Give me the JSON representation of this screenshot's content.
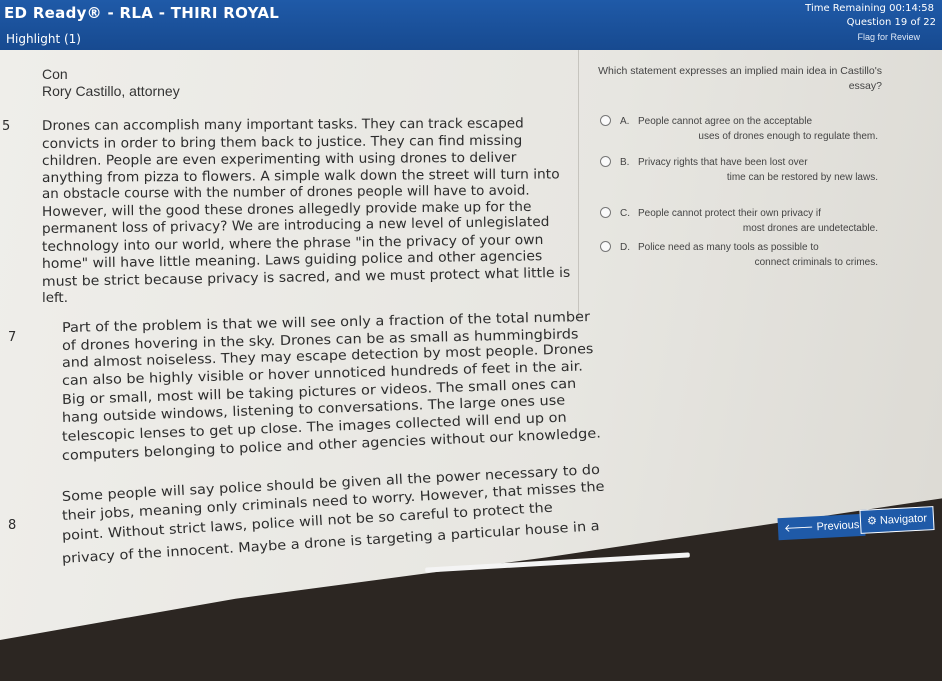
{
  "header": {
    "app_title": "ED Ready® - RLA - THIRI ROYAL",
    "timer": "Time Remaining 00:14:58",
    "question_count": "Question 19 of 22",
    "highlight_label": "Highlight (1)",
    "flag_label": "Flag for Review"
  },
  "passage": {
    "title": "Con",
    "author": "Rory Castillo, attorney",
    "paragraph_numbers": [
      "5",
      "7",
      "8"
    ],
    "lines": [
      "Drones can accomplish many important tasks. They can track escaped",
      "convicts in order to bring them back to justice. They can find missing",
      "children. People are even experimenting with using drones to deliver",
      "anything from pizza to flowers. A simple walk down the street will turn into",
      "an obstacle course with the number of drones people will have to avoid.",
      "However, will the good these drones allegedly provide make up for the",
      "permanent loss of privacy? We are introducing a new level of unlegislated",
      "technology into our world, where the phrase \"in the privacy of your own",
      "home\" will have little meaning. Laws guiding police and other agencies",
      "must be strict because privacy is sacred, and we must protect what little is",
      "left.",
      "Part of the problem is that we will see only a fraction of the total number",
      "of drones hovering in the sky. Drones can be as small as hummingbirds",
      "and almost noiseless. They may escape detection by most people. Drones",
      "can also be highly visible or hover unnoticed hundreds of feet in the air.",
      "Big or small, most will be taking pictures or videos. The small ones can",
      "hang outside windows, listening to conversations. The large ones use",
      "telescopic lenses to get up close. The images collected will end up on",
      "computers belonging to police and other agencies without our knowledge.",
      "Some people will say police should be given all the power necessary to do",
      "their jobs, meaning only criminals need to worry. However, that misses the",
      "point. Without strict laws, police will not be so careful to protect the",
      "privacy of the innocent. Maybe a drone is targeting a particular house in a"
    ]
  },
  "question": {
    "prompt": "Which statement expresses an implied main idea in Castillo's essay?",
    "choices": [
      {
        "letter": "A.",
        "line1": "People cannot agree on the acceptable",
        "line2": "uses of drones enough to regulate them."
      },
      {
        "letter": "B.",
        "line1": "Privacy rights that have been lost over",
        "line2": "time can be restored by new laws."
      },
      {
        "letter": "C.",
        "line1": "People cannot protect their own privacy if",
        "line2": "most drones are undetectable."
      },
      {
        "letter": "D.",
        "line1": "Police need as many tools as possible to",
        "line2": "connect criminals to crimes."
      }
    ]
  },
  "nav": {
    "previous_label": "Previous",
    "navigator_label": "Navigator"
  }
}
